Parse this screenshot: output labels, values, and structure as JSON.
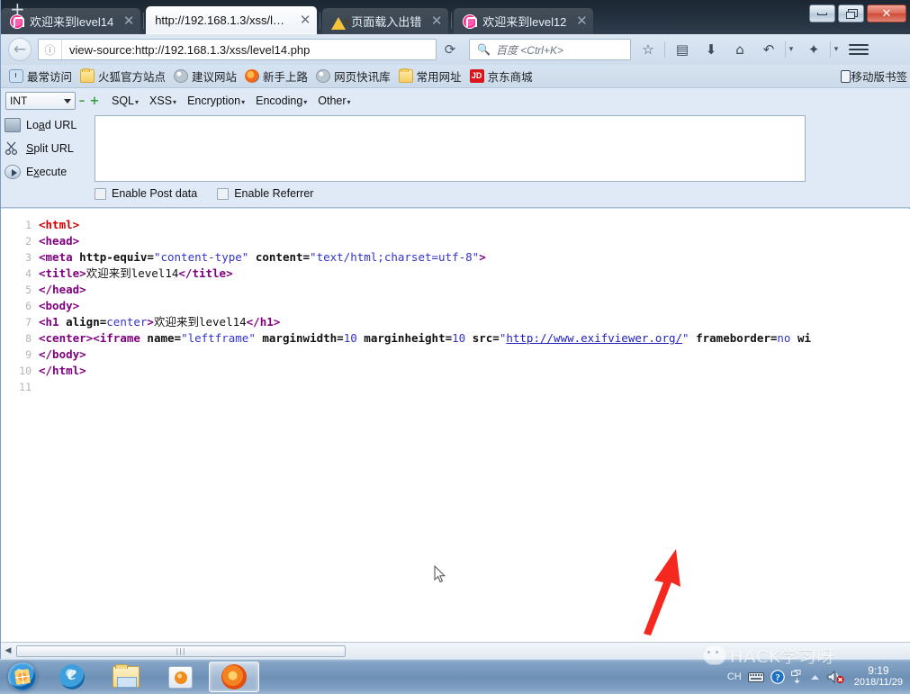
{
  "window": {
    "minimize_label": "Minimize",
    "maximize_label": "Maximize",
    "close_label": "✕"
  },
  "tabs": [
    {
      "title": "欢迎来到level14",
      "favicon": "pink-flower-icon",
      "active": false,
      "close": "✕"
    },
    {
      "title": "http://192.168.1.3/xss/level1...",
      "favicon": "none",
      "active": true,
      "close": "✕"
    },
    {
      "title": "页面载入出错",
      "favicon": "warning-triangle-icon",
      "active": false,
      "close": "✕"
    },
    {
      "title": "欢迎来到level12",
      "favicon": "pink-flower-icon",
      "active": false,
      "close": "✕"
    }
  ],
  "newtab_label": "+",
  "nav": {
    "back_glyph": "←",
    "site_info_glyph": "ⓘ",
    "url": "view-source:http://192.168.1.3/xss/level14.php",
    "reload_glyph": "⟳",
    "search_placeholder": "百度 <Ctrl+K>",
    "search_glyph": "🔍",
    "icons": [
      {
        "name": "bookmark-star-icon",
        "glyph": "☆"
      },
      {
        "name": "reading-list-icon",
        "glyph": "▤"
      },
      {
        "name": "downloads-icon",
        "glyph": "⬇"
      },
      {
        "name": "home-icon",
        "glyph": "⌂"
      },
      {
        "name": "history-back-icon",
        "glyph": "↶"
      },
      {
        "name": "addon-icon",
        "glyph": "✦"
      }
    ],
    "menu_label": "☰"
  },
  "bookmarks": {
    "items": [
      {
        "label": "最常访问",
        "icon": "most-visited-icon"
      },
      {
        "label": "火狐官方站点",
        "icon": "folder-icon"
      },
      {
        "label": "建议网站",
        "icon": "globe-icon"
      },
      {
        "label": "新手上路",
        "icon": "firefox-icon"
      },
      {
        "label": "网页快讯库",
        "icon": "globe-icon"
      },
      {
        "label": "常用网址",
        "icon": "folder-icon"
      },
      {
        "label": "京东商城",
        "icon": "jd-icon",
        "icon_text": "JD"
      }
    ],
    "right_item": {
      "label": "移动版书签",
      "icon": "mobile-icon"
    }
  },
  "hackbar": {
    "type_select": {
      "value": "INT"
    },
    "minus_label": "–",
    "plus_label": "+",
    "menus": [
      {
        "label": "SQL"
      },
      {
        "label": "XSS"
      },
      {
        "label": "Encryption"
      },
      {
        "label": "Encoding"
      },
      {
        "label": "Other"
      }
    ],
    "caret": "▾",
    "actions": [
      {
        "label_pre": "Lo",
        "label_u": "a",
        "label_post": "d URL",
        "icon": "load-url-icon"
      },
      {
        "label_pre": "",
        "label_u": "S",
        "label_post": "plit URL",
        "icon": "split-url-icon"
      },
      {
        "label_pre": "E",
        "label_u": "x",
        "label_post": "ecute",
        "icon": "execute-icon"
      }
    ],
    "textarea_value": "",
    "checkboxes": [
      {
        "label": "Enable Post data",
        "checked": false
      },
      {
        "label": "Enable Referrer",
        "checked": false
      }
    ]
  },
  "source": {
    "lines": [
      {
        "n": "1",
        "segs": [
          {
            "c": "tag1",
            "t": "<html>"
          }
        ]
      },
      {
        "n": "2",
        "segs": [
          {
            "c": "tag",
            "t": "<head>"
          }
        ]
      },
      {
        "n": "3",
        "segs": [
          {
            "c": "tag",
            "t": "<meta"
          },
          {
            "c": "attr",
            "t": " http-equiv="
          },
          {
            "c": "val",
            "t": "\"content-type\""
          },
          {
            "c": "attr",
            "t": " content="
          },
          {
            "c": "val",
            "t": "\"text/html;charset=utf-8\""
          },
          {
            "c": "tag",
            "t": ">"
          }
        ]
      },
      {
        "n": "4",
        "segs": [
          {
            "c": "tag",
            "t": "<title>"
          },
          {
            "c": "txt cjk",
            "t": "欢迎来到"
          },
          {
            "c": "txt",
            "t": "level14"
          },
          {
            "c": "tag",
            "t": "</title>"
          }
        ]
      },
      {
        "n": "5",
        "segs": [
          {
            "c": "tag",
            "t": "</head>"
          }
        ]
      },
      {
        "n": "6",
        "segs": [
          {
            "c": "tag",
            "t": "<body>"
          }
        ]
      },
      {
        "n": "7",
        "segs": [
          {
            "c": "tag",
            "t": "<h1"
          },
          {
            "c": "attr",
            "t": " align="
          },
          {
            "c": "val",
            "t": "center"
          },
          {
            "c": "tag",
            "t": ">"
          },
          {
            "c": "txt cjk",
            "t": "欢迎来到"
          },
          {
            "c": "txt",
            "t": "level14"
          },
          {
            "c": "tag",
            "t": "</h1>"
          }
        ]
      },
      {
        "n": "8",
        "segs": [
          {
            "c": "tag",
            "t": "<center>"
          },
          {
            "c": "tag",
            "t": "<iframe"
          },
          {
            "c": "attr",
            "t": " name="
          },
          {
            "c": "val",
            "t": "\"leftframe\""
          },
          {
            "c": "attr",
            "t": " marginwidth="
          },
          {
            "c": "val",
            "t": "10"
          },
          {
            "c": "attr",
            "t": " marginheight="
          },
          {
            "c": "val",
            "t": "10"
          },
          {
            "c": "attr",
            "t": " src="
          },
          {
            "c": "val",
            "t": "\""
          },
          {
            "c": "lnk",
            "t": "http://www.exifviewer.org/"
          },
          {
            "c": "val",
            "t": "\""
          },
          {
            "c": "attr",
            "t": " frameborder="
          },
          {
            "c": "val",
            "t": "no"
          },
          {
            "c": "attr",
            "t": " wi"
          }
        ]
      },
      {
        "n": "9",
        "segs": [
          {
            "c": "tag",
            "t": "</body>"
          }
        ]
      },
      {
        "n": "10",
        "segs": [
          {
            "c": "tag",
            "t": "</html>"
          }
        ]
      },
      {
        "n": "11",
        "segs": []
      }
    ]
  },
  "scrollbar": {
    "left_arrow": "◀",
    "thumb_grip": "|||"
  },
  "taskbar": {
    "start_label": "Start",
    "items": [
      {
        "name": "internet-explorer",
        "active": false
      },
      {
        "name": "windows-explorer",
        "active": false
      },
      {
        "name": "windows-media-player",
        "active": false
      },
      {
        "name": "firefox",
        "active": true
      }
    ],
    "tray": {
      "ime_label": "CH",
      "keyboard_glyph": "⌨",
      "help_glyph": "?",
      "network_glyph": "🖧",
      "show_hidden_glyph": "▲",
      "volume_glyph": "🔊",
      "time": "9:19",
      "date": "2018/11/29"
    }
  },
  "watermark": {
    "text": "HACK学习呀",
    "icon": "wechat-icon"
  },
  "annotation": {
    "arrow_color": "#f4281e",
    "points_to": "http://www.exifviewer.org/"
  },
  "colors": {
    "tag_purple": "#800080",
    "tag_red": "#cc0000",
    "attr_value_blue": "#3333cc",
    "link_blue": "#2222bb",
    "hackbar_bg": "#dfeaf6",
    "arrow_red": "#f4281e"
  }
}
